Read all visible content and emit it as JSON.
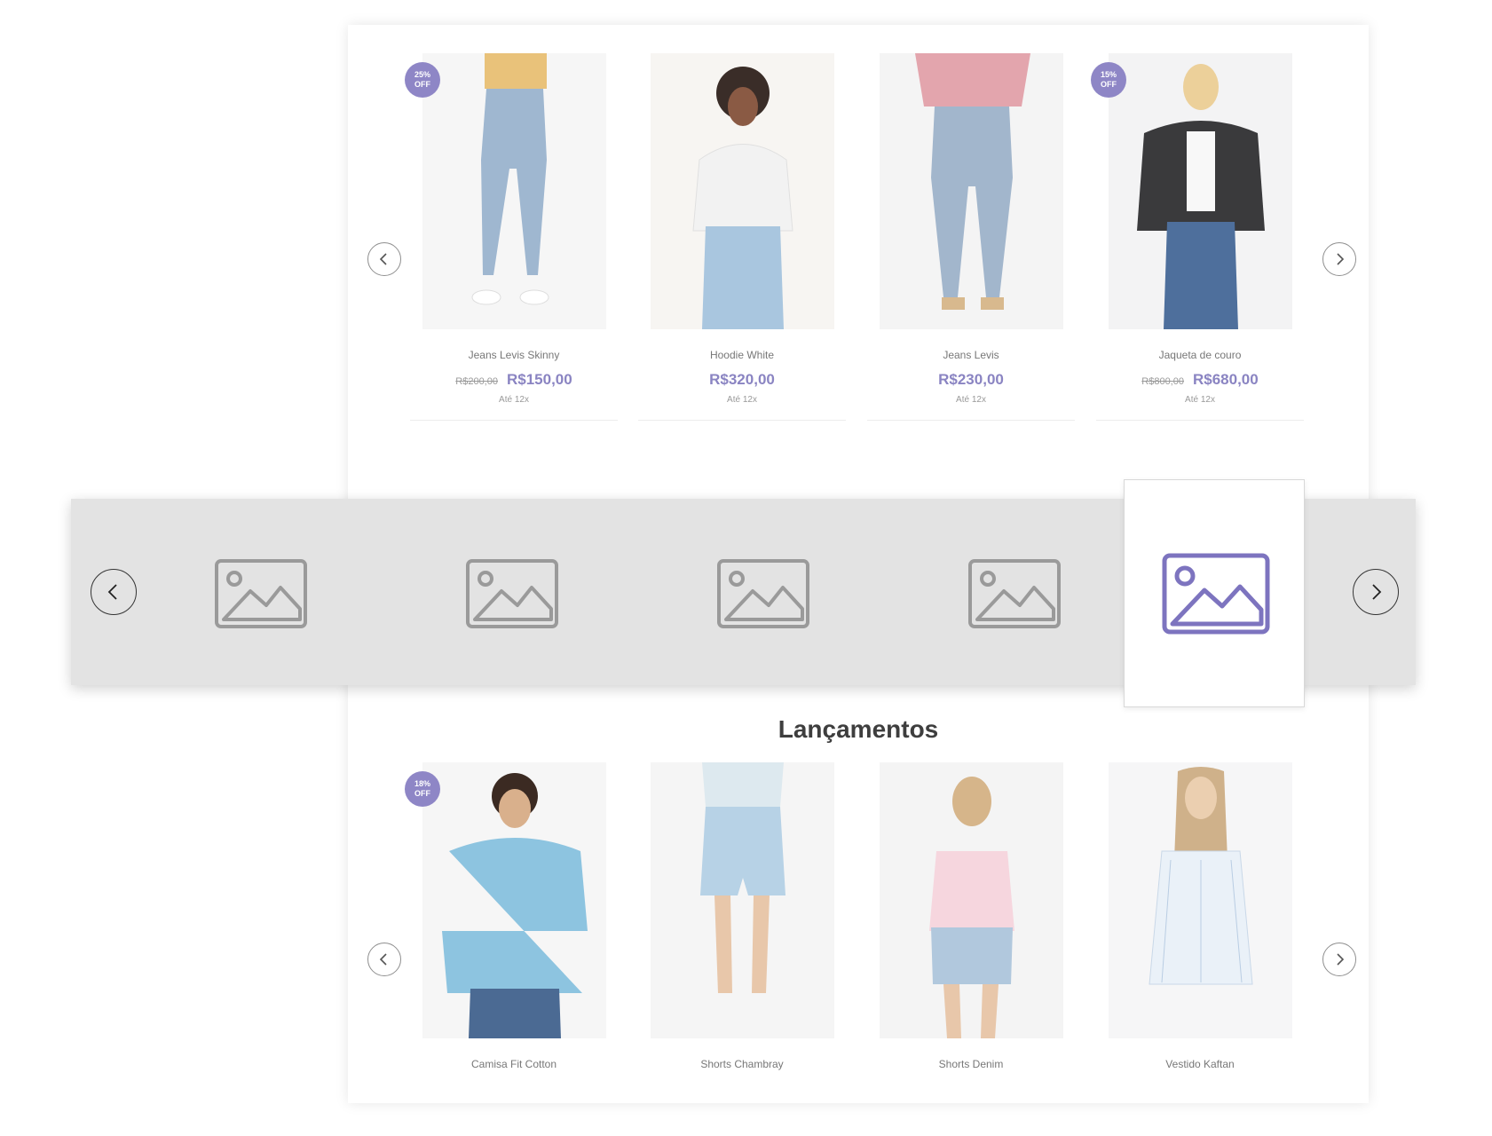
{
  "colors": {
    "accent": "#8a84c2",
    "badge": "#8e86c6",
    "banner_bg": "#e3e3e3",
    "placeholder_gray": "#9a9a9a"
  },
  "top_carousel": {
    "prev_icon": "chevron-left-icon",
    "next_icon": "chevron-right-icon",
    "products": [
      {
        "name": "Jeans Levis Skinny",
        "badge_line1": "25%",
        "badge_line2": "OFF",
        "old_price": "R$200,00",
        "price": "R$150,00",
        "installments": "Até 12x"
      },
      {
        "name": "Hoodie White",
        "badge_line1": "",
        "badge_line2": "",
        "old_price": "",
        "price": "R$320,00",
        "installments": "Até 12x"
      },
      {
        "name": "Jeans Levis",
        "badge_line1": "",
        "badge_line2": "",
        "old_price": "",
        "price": "R$230,00",
        "installments": "Até 12x"
      },
      {
        "name": "Jaqueta de couro",
        "badge_line1": "15%",
        "badge_line2": "OFF",
        "old_price": "R$800,00",
        "price": "R$680,00",
        "installments": "Até 12x"
      }
    ]
  },
  "banner": {
    "thumbnails": [
      "image-placeholder-icon",
      "image-placeholder-icon",
      "image-placeholder-icon",
      "image-placeholder-icon"
    ],
    "active_thumbnail": "image-placeholder-icon"
  },
  "launches": {
    "title": "Lançamentos",
    "products": [
      {
        "name": "Camisa Fit Cotton",
        "badge_line1": "18%",
        "badge_line2": "OFF"
      },
      {
        "name": "Shorts Chambray",
        "badge_line1": "",
        "badge_line2": ""
      },
      {
        "name": "Shorts Denim",
        "badge_line1": "",
        "badge_line2": ""
      },
      {
        "name": "Vestido Kaftan",
        "badge_line1": "",
        "badge_line2": ""
      }
    ]
  }
}
